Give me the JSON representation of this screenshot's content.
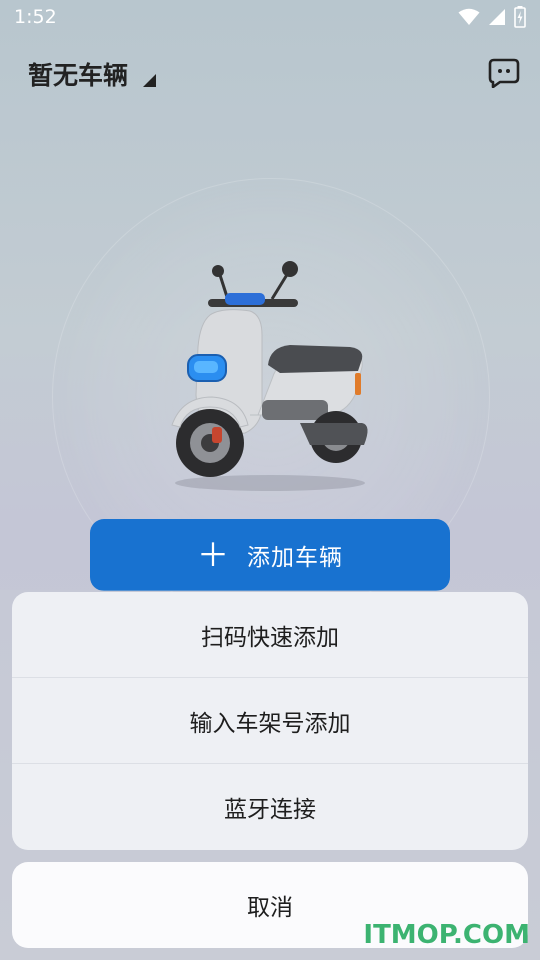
{
  "status_bar": {
    "time": "1:52",
    "icons": [
      "wifi-icon",
      "cellular-signal-icon",
      "battery-charging-icon"
    ]
  },
  "header": {
    "title": "暂无车辆",
    "title_icon": "dropdown-triangle-icon",
    "message_icon": "chat-bubble-icon"
  },
  "hero": {
    "image": "electric-scooter-illustration"
  },
  "add_button": {
    "icon": "plus-icon",
    "plus": "＋",
    "label": "添加车辆",
    "color": "#1872d0"
  },
  "action_sheet": {
    "items": [
      {
        "label": "扫码快速添加"
      },
      {
        "label": "输入车架号添加"
      },
      {
        "label": "蓝牙连接"
      }
    ],
    "cancel_label": "取消"
  },
  "watermark": {
    "text": "ITMOP.COM",
    "color": "#3cb371"
  }
}
